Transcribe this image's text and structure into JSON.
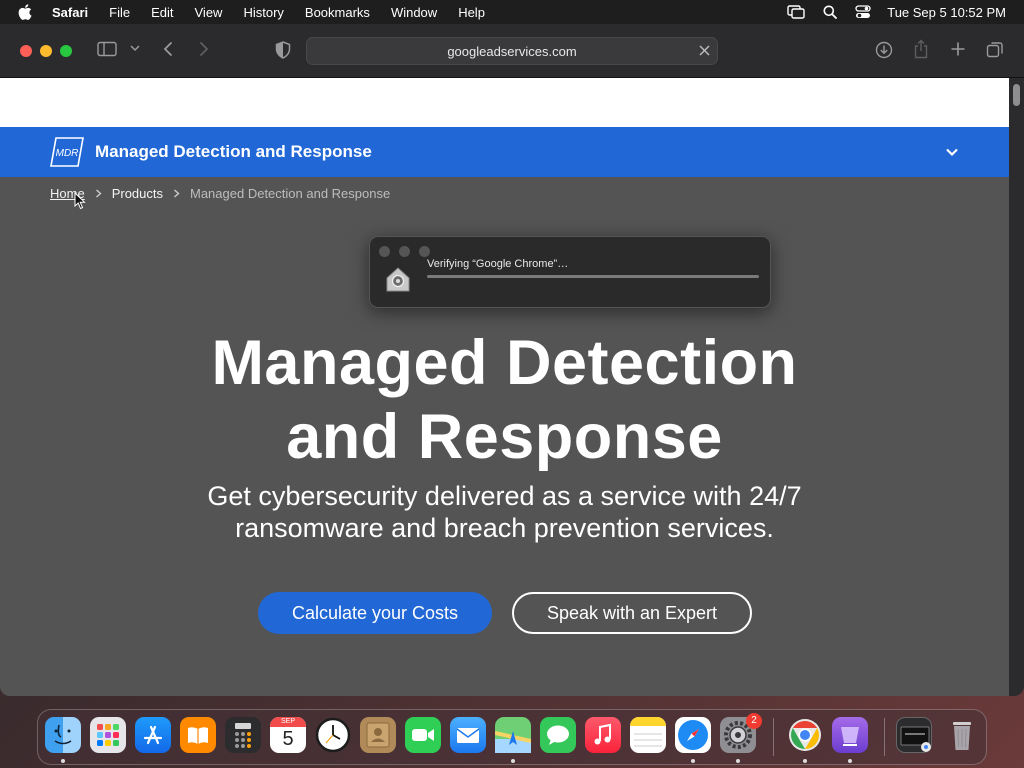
{
  "menubar": {
    "app_name": "Safari",
    "items": [
      "File",
      "Edit",
      "View",
      "History",
      "Bookmarks",
      "Window",
      "Help"
    ],
    "clock": "Tue Sep 5  10:52 PM"
  },
  "browser": {
    "url": "googleadservices.com"
  },
  "site": {
    "product_bar_title": "Managed Detection and Response",
    "logo_text": "MDR",
    "breadcrumb": {
      "home": "Home",
      "products": "Products",
      "current": "Managed Detection and Response"
    },
    "hero": {
      "title_line1": "Managed Detection",
      "title_line2": "and Response",
      "subtitle_line1": "Get cybersecurity delivered as a service with 24/7",
      "subtitle_line2": "ransomware and breach prevention services."
    },
    "cta_primary": "Calculate your Costs",
    "cta_secondary": "Speak with an Expert"
  },
  "dialog": {
    "message": "Verifying “Google Chrome”…"
  },
  "dock": {
    "calendar_month": "SEP",
    "calendar_day": "5",
    "settings_badge": "2",
    "apps": [
      "Finder",
      "Launchpad",
      "App Store",
      "Books",
      "Calculator",
      "Calendar",
      "Clock",
      "Contacts",
      "FaceTime",
      "Mail",
      "Maps",
      "Messages",
      "Music",
      "Notes",
      "Safari",
      "System Settings",
      "Google Chrome",
      "Simulator",
      "Downloads",
      "Trash"
    ]
  },
  "colors": {
    "brand_blue": "#2168d6",
    "page_bg": "#545454"
  }
}
